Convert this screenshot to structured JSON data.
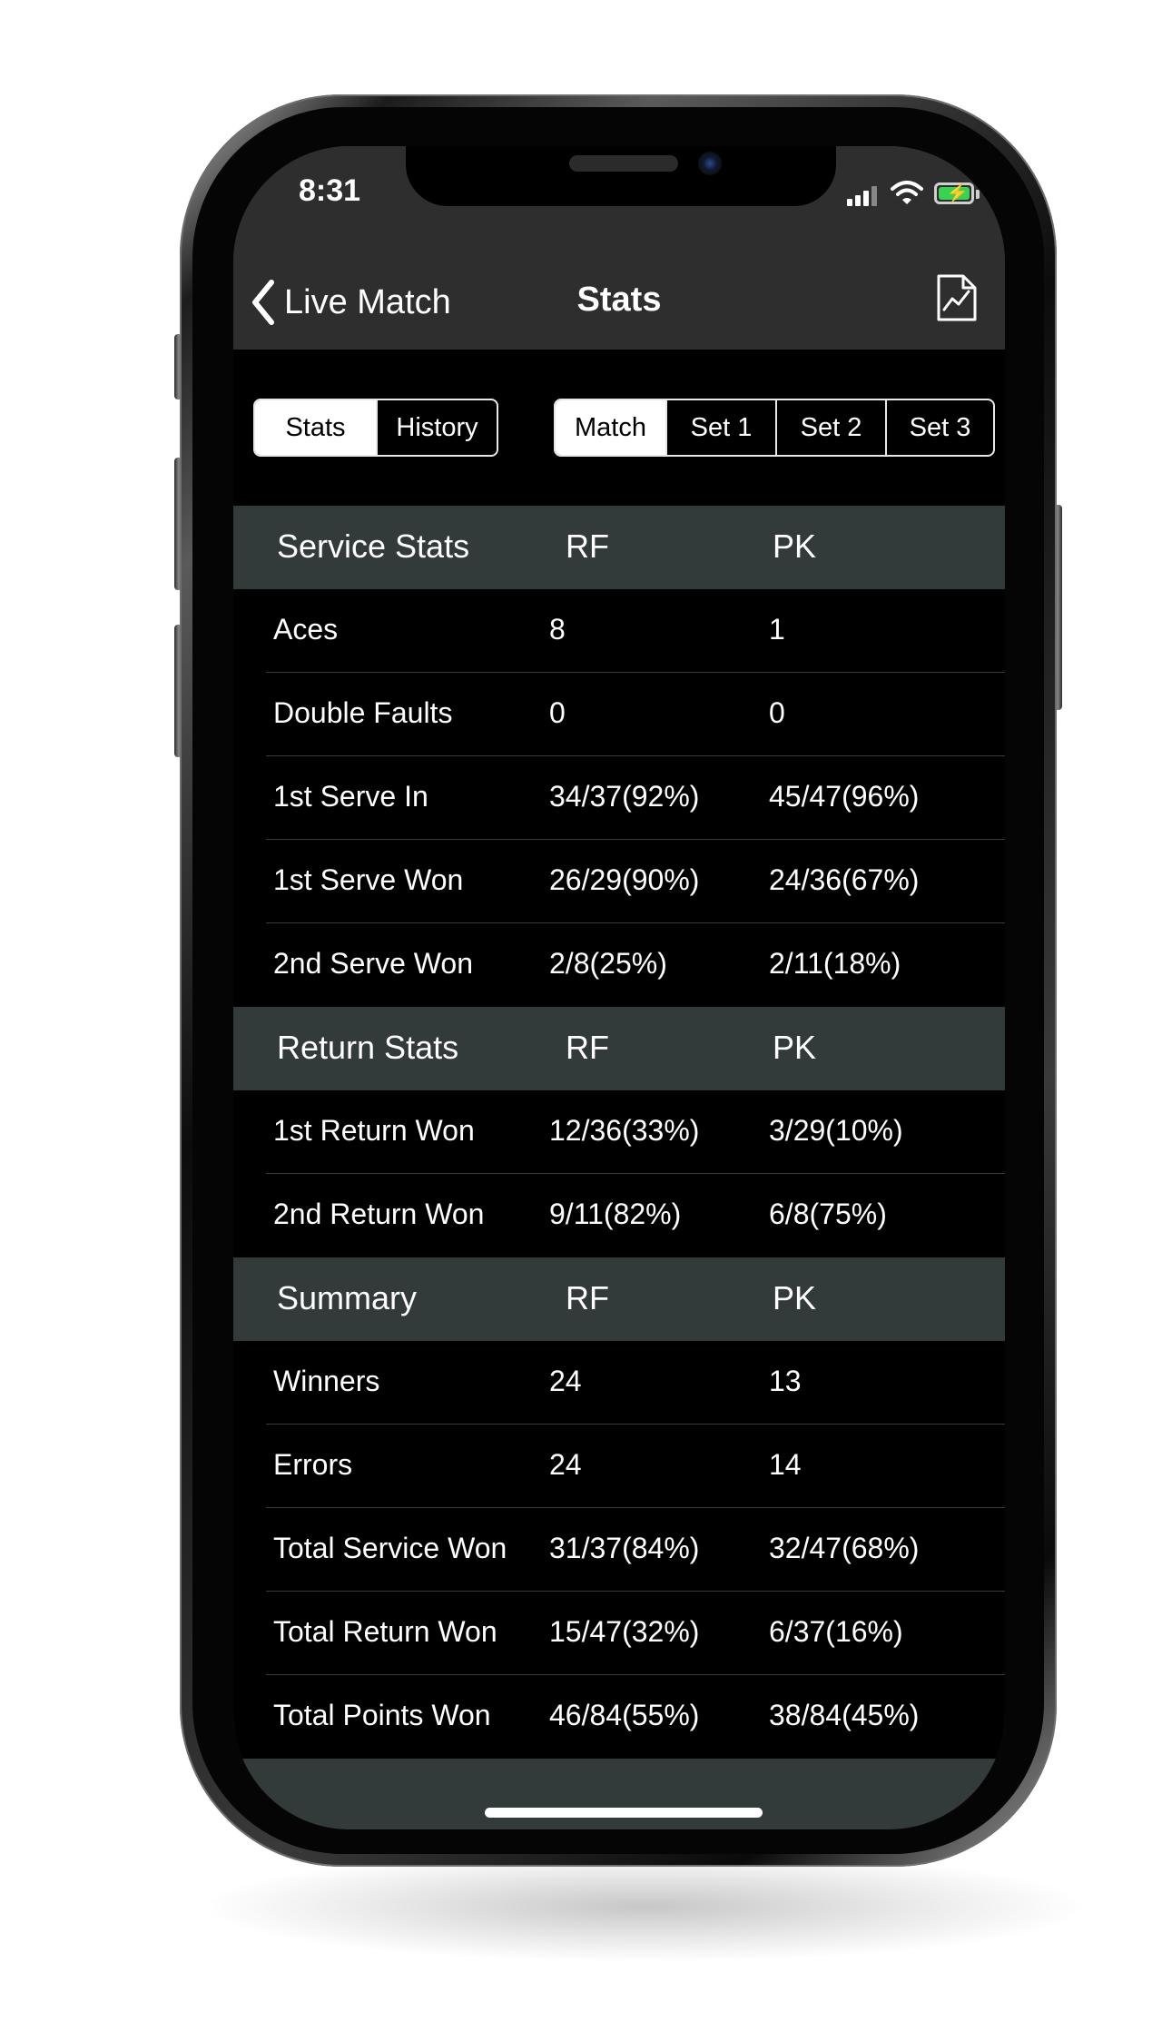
{
  "status": {
    "time": "8:31"
  },
  "nav": {
    "back_label": "Live Match",
    "title": "Stats"
  },
  "view_switch": {
    "options": [
      "Stats",
      "History"
    ],
    "selected": "Stats"
  },
  "period_switch": {
    "options": [
      "Match",
      "Set 1",
      "Set 2",
      "Set 3"
    ],
    "selected": "Match"
  },
  "sections": [
    {
      "title": "Service Stats",
      "col1": "RF",
      "col2": "PK",
      "rows": [
        {
          "label": "Aces",
          "rf": "8",
          "pk": "1"
        },
        {
          "label": "Double Faults",
          "rf": "0",
          "pk": "0"
        },
        {
          "label": "1st Serve In",
          "rf": "34/37(92%)",
          "pk": "45/47(96%)"
        },
        {
          "label": "1st Serve Won",
          "rf": "26/29(90%)",
          "pk": "24/36(67%)"
        },
        {
          "label": "2nd Serve Won",
          "rf": "2/8(25%)",
          "pk": "2/11(18%)"
        }
      ]
    },
    {
      "title": "Return Stats",
      "col1": "RF",
      "col2": "PK",
      "rows": [
        {
          "label": "1st Return Won",
          "rf": "12/36(33%)",
          "pk": "3/29(10%)"
        },
        {
          "label": "2nd Return Won",
          "rf": "9/11(82%)",
          "pk": "6/8(75%)"
        }
      ]
    },
    {
      "title": "Summary",
      "col1": "RF",
      "col2": "PK",
      "rows": [
        {
          "label": "Winners",
          "rf": "24",
          "pk": "13"
        },
        {
          "label": "Errors",
          "rf": "24",
          "pk": "14"
        },
        {
          "label": "Total Service Won",
          "rf": "31/37(84%)",
          "pk": "32/47(68%)"
        },
        {
          "label": "Total Return Won",
          "rf": "15/47(32%)",
          "pk": "6/37(16%)"
        },
        {
          "label": "Total Points Won",
          "rf": "46/84(55%)",
          "pk": "38/84(45%)"
        }
      ]
    }
  ],
  "icons": {
    "back": "chevron-left-icon",
    "export": "chart-document-icon",
    "signal": "cellular-signal-icon",
    "wifi": "wifi-icon",
    "battery": "battery-charging-icon"
  },
  "colors": {
    "bar_background": "#2e2e2e",
    "section_header": "#323a3a",
    "row_background": "#000000",
    "battery_green": "#39d353"
  }
}
